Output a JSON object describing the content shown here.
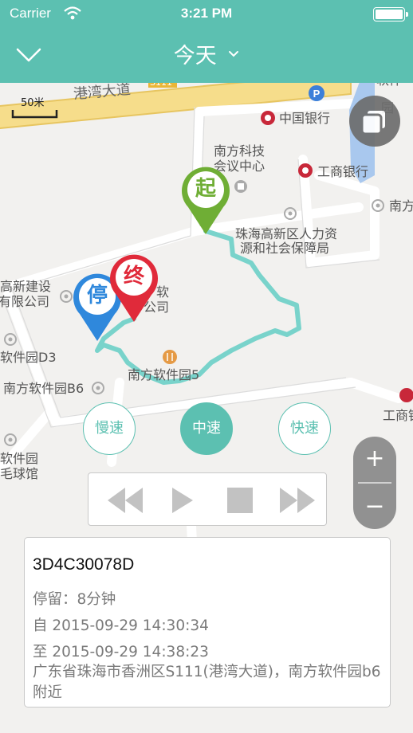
{
  "status_bar": {
    "carrier": "Carrier",
    "time": "3:21 PM"
  },
  "nav": {
    "title": "今天"
  },
  "map": {
    "scale_label": "50米",
    "road_name": "港湾大道",
    "road_code": "S111",
    "pois": {
      "bank_china": "中国银行",
      "conference_line1": "南方科技",
      "conference_line2": "会议中心",
      "icbc": "工商银行",
      "nanfang_right": "南方",
      "hr_line1": "珠海高新区人力资",
      "hr_line2": "源和社会保障局",
      "gaoxin_line1": "高新建设",
      "gaoxin_line2": "有限公司",
      "ruan_line1": "软",
      "ruan_line2": "公司",
      "d3": "软件园D3",
      "nanfang_park5": "南方软件园5",
      "b6": "南方软件园B6",
      "icbc_lower": "工商银",
      "park_line1": "软件园",
      "park_line2": "毛球馆",
      "right_top_line1": "软件",
      "right_top_line2": "园",
      "road_bottom": "东"
    }
  },
  "pins": {
    "start": "起",
    "stop": "停",
    "end": "终"
  },
  "speed": {
    "slow": "慢速",
    "medium": "中速",
    "fast": "快速",
    "active": "medium"
  },
  "zoom": {
    "in": "+",
    "out": "−"
  },
  "info": {
    "plate": "3D4C30078D",
    "stay": "停留：8分钟",
    "from": "自 2015-09-29 14:30:34",
    "to": "至 2015-09-29 14:38:23",
    "address": "广东省珠海市香洲区S111(港湾大道)，南方软件园b6附近"
  },
  "colors": {
    "header": "#5cc0b1",
    "track": "#6ccfc6",
    "pin_start": "#6fae35",
    "pin_stop": "#2f88dc",
    "pin_end": "#e02a3a"
  }
}
